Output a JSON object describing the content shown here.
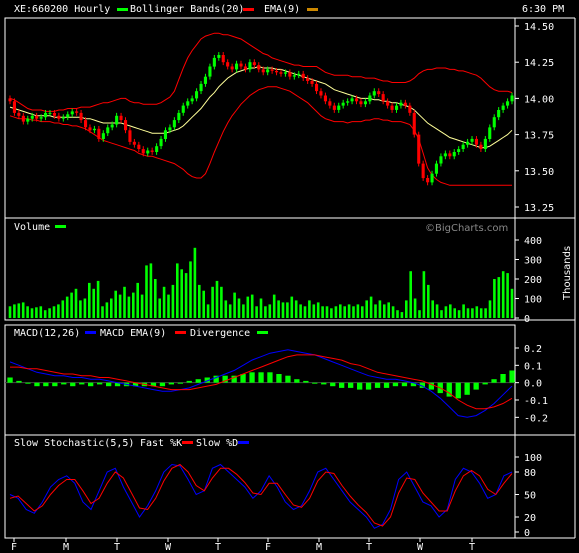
{
  "header": {
    "symbol_label": "XE:660200 Hourly",
    "bb_label": "Bollinger Bands(20)",
    "ema_label": "EMA(9)",
    "time": "6:30 PM"
  },
  "watermark": "©BigCharts.com",
  "colors": {
    "background": "#000000",
    "frame": "#ffffff",
    "up": "#00ff00",
    "down": "#ff0000",
    "bollinger": "#ff0000",
    "ema": "#ffff99",
    "macd": "#0000ff",
    "macd_ema": "#ff0000",
    "divergence": "#00ff00",
    "volume": "#00ff00",
    "fast_k": "#0000ff",
    "slow_d": "#ff0000"
  },
  "chart_data": [
    {
      "type": "candlestick",
      "panel": "price",
      "ylim": [
        13.25,
        14.5
      ],
      "yticks": [
        "14.50",
        "14.25",
        "14.00",
        "13.75",
        "13.50",
        "13.25"
      ],
      "close": [
        13.98,
        13.9,
        13.88,
        13.84,
        13.86,
        13.88,
        13.86,
        13.87,
        13.9,
        13.9,
        13.88,
        13.86,
        13.87,
        13.89,
        13.91,
        13.9,
        13.85,
        13.8,
        13.78,
        13.79,
        13.72,
        13.76,
        13.8,
        13.82,
        13.88,
        13.85,
        13.78,
        13.7,
        13.68,
        13.65,
        13.62,
        13.64,
        13.63,
        13.67,
        13.72,
        13.78,
        13.8,
        13.85,
        13.9,
        13.95,
        13.98,
        14.0,
        14.05,
        14.1,
        14.15,
        14.22,
        14.28,
        14.3,
        14.25,
        14.22,
        14.2,
        14.24,
        14.22,
        14.2,
        14.25,
        14.23,
        14.2,
        14.18,
        14.2,
        14.19,
        14.18,
        14.17,
        14.18,
        14.15,
        14.16,
        14.17,
        14.14,
        14.12,
        14.1,
        14.05,
        14.02,
        13.98,
        13.95,
        13.92,
        13.95,
        13.97,
        13.98,
        14.0,
        13.98,
        13.96,
        13.98,
        14.02,
        14.05,
        14.03,
        13.98,
        13.95,
        13.92,
        13.95,
        13.97,
        13.95,
        13.9,
        13.75,
        13.55,
        13.45,
        13.42,
        13.48,
        13.55,
        13.6,
        13.62,
        13.6,
        13.63,
        13.65,
        13.68,
        13.7,
        13.72,
        13.68,
        13.65,
        13.72,
        13.8,
        13.87,
        13.92,
        13.95,
        13.98,
        14.02
      ],
      "overlays": {
        "bollinger_upper": [
          14.0,
          13.99,
          13.97,
          13.95,
          13.93,
          13.92,
          13.92,
          13.92,
          13.91,
          13.91,
          13.91,
          13.92,
          13.92,
          13.93,
          13.93,
          13.93,
          13.94,
          13.94,
          13.94,
          13.95,
          13.96,
          13.97,
          13.97,
          13.98,
          13.99,
          14.0,
          14.0,
          13.98,
          13.97,
          13.97,
          13.96,
          13.96,
          13.96,
          13.96,
          13.97,
          13.99,
          14.01,
          14.05,
          14.13,
          14.21,
          14.28,
          14.33,
          14.37,
          14.41,
          14.43,
          14.44,
          14.45,
          14.45,
          14.44,
          14.44,
          14.43,
          14.42,
          14.41,
          14.39,
          14.37,
          14.35,
          14.33,
          14.31,
          14.3,
          14.28,
          14.27,
          14.26,
          14.25,
          14.24,
          14.23,
          14.23,
          14.22,
          14.22,
          14.22,
          14.22,
          14.2,
          14.18,
          14.17,
          14.16,
          14.16,
          14.16,
          14.16,
          14.15,
          14.15,
          14.15,
          14.14,
          14.14,
          14.14,
          14.13,
          14.12,
          14.12,
          14.11,
          14.11,
          14.11,
          14.11,
          14.12,
          14.14,
          14.17,
          14.19,
          14.2,
          14.2,
          14.21,
          14.21,
          14.21,
          14.2,
          14.2,
          14.19,
          14.19,
          14.18,
          14.17,
          14.16,
          14.14,
          14.11,
          14.08,
          14.06,
          14.05,
          14.05,
          14.05,
          14.04
        ],
        "bollinger_middle": [
          13.94,
          13.93,
          13.92,
          13.91,
          13.9,
          13.89,
          13.88,
          13.88,
          13.88,
          13.88,
          13.87,
          13.87,
          13.87,
          13.87,
          13.87,
          13.87,
          13.87,
          13.86,
          13.86,
          13.85,
          13.84,
          13.83,
          13.83,
          13.83,
          13.83,
          13.83,
          13.82,
          13.81,
          13.8,
          13.79,
          13.78,
          13.77,
          13.76,
          13.76,
          13.76,
          13.76,
          13.77,
          13.78,
          13.79,
          13.81,
          13.84,
          13.87,
          13.9,
          13.93,
          13.97,
          14.01,
          14.04,
          14.08,
          14.11,
          14.14,
          14.16,
          14.18,
          14.19,
          14.2,
          14.21,
          14.21,
          14.22,
          14.21,
          14.21,
          14.21,
          14.2,
          14.2,
          14.19,
          14.18,
          14.17,
          14.16,
          14.15,
          14.14,
          14.13,
          14.12,
          14.11,
          14.1,
          14.08,
          14.06,
          14.05,
          14.04,
          14.03,
          14.02,
          14.01,
          14.0,
          14.0,
          14.0,
          13.99,
          13.99,
          13.98,
          13.98,
          13.97,
          13.97,
          13.96,
          13.95,
          13.94,
          13.92,
          13.89,
          13.86,
          13.83,
          13.81,
          13.79,
          13.77,
          13.75,
          13.73,
          13.72,
          13.71,
          13.7,
          13.69,
          13.68,
          13.67,
          13.66,
          13.66,
          13.67,
          13.69,
          13.71,
          13.73,
          13.75,
          13.78
        ],
        "bollinger_lower": [
          13.88,
          13.87,
          13.86,
          13.86,
          13.86,
          13.85,
          13.85,
          13.84,
          13.84,
          13.84,
          13.83,
          13.83,
          13.82,
          13.82,
          13.81,
          13.81,
          13.8,
          13.79,
          13.77,
          13.75,
          13.73,
          13.71,
          13.7,
          13.69,
          13.68,
          13.67,
          13.66,
          13.65,
          13.64,
          13.62,
          13.61,
          13.6,
          13.6,
          13.59,
          13.58,
          13.57,
          13.56,
          13.55,
          13.53,
          13.51,
          13.48,
          13.46,
          13.45,
          13.45,
          13.48,
          13.55,
          13.63,
          13.7,
          13.77,
          13.83,
          13.88,
          13.92,
          13.96,
          13.99,
          14.02,
          14.04,
          14.06,
          14.07,
          14.08,
          14.08,
          14.08,
          14.07,
          14.06,
          14.05,
          14.03,
          14.01,
          13.99,
          13.97,
          13.94,
          13.91,
          13.88,
          13.86,
          13.85,
          13.84,
          13.84,
          13.84,
          13.83,
          13.84,
          13.84,
          13.84,
          13.85,
          13.85,
          13.86,
          13.86,
          13.85,
          13.85,
          13.84,
          13.84,
          13.84,
          13.83,
          13.82,
          13.78,
          13.72,
          13.62,
          13.52,
          13.47,
          13.44,
          13.42,
          13.41,
          13.4,
          13.4,
          13.4,
          13.4,
          13.4,
          13.4,
          13.4,
          13.4,
          13.4,
          13.4,
          13.4,
          13.4,
          13.4,
          13.4,
          13.4
        ],
        "ema": [
          13.95,
          13.94,
          13.93,
          13.91,
          13.9,
          13.89,
          13.88,
          13.88,
          13.88,
          13.89,
          13.88,
          13.87,
          13.87,
          13.87,
          13.88,
          13.88,
          13.87,
          13.86,
          13.84,
          13.82,
          13.8,
          13.79,
          13.79,
          13.79,
          13.81,
          13.82,
          13.81,
          13.79,
          13.77,
          13.75,
          13.72,
          13.7,
          13.69,
          13.68,
          13.69,
          13.71,
          13.73,
          13.75,
          13.78,
          13.82,
          13.85,
          13.88,
          13.91,
          13.95,
          13.99,
          14.04,
          14.09,
          14.13,
          14.15,
          14.17,
          14.18,
          14.19,
          14.2,
          14.2,
          14.21,
          14.21,
          14.21,
          14.2,
          14.2,
          14.2,
          14.2,
          14.19,
          14.19,
          14.18,
          14.18,
          14.18,
          14.17,
          14.16,
          14.15,
          14.13,
          14.11,
          14.08,
          14.06,
          14.03,
          14.02,
          14.01,
          14.0,
          14.0,
          14.0,
          13.99,
          13.99,
          13.99,
          14.0,
          14.01,
          14.0,
          13.99,
          13.97,
          13.97,
          13.96,
          13.96,
          13.95,
          13.91,
          13.84,
          13.76,
          13.7,
          13.65,
          13.63,
          13.62,
          13.62,
          13.62,
          13.62,
          13.63,
          13.64,
          13.65,
          13.67,
          13.67,
          13.67,
          13.68,
          13.7,
          13.73,
          13.77,
          13.81,
          13.84,
          13.88
        ]
      }
    },
    {
      "type": "bar",
      "panel": "volume",
      "title": "Volume",
      "ylabel": "Thousands",
      "ylim": [
        0,
        400
      ],
      "yticks": [
        "400",
        "300",
        "200",
        "100",
        "0"
      ],
      "values": [
        60,
        70,
        75,
        80,
        60,
        50,
        55,
        60,
        40,
        50,
        60,
        70,
        90,
        110,
        130,
        150,
        90,
        100,
        180,
        150,
        190,
        60,
        80,
        100,
        140,
        120,
        160,
        110,
        130,
        180,
        120,
        270,
        280,
        200,
        100,
        160,
        120,
        170,
        280,
        250,
        230,
        290,
        360,
        170,
        140,
        70,
        160,
        190,
        160,
        90,
        70,
        130,
        100,
        70,
        110,
        120,
        60,
        100,
        60,
        70,
        120,
        90,
        80,
        80,
        110,
        90,
        70,
        60,
        90,
        70,
        80,
        60,
        60,
        50,
        60,
        70,
        60,
        70,
        60,
        70,
        60,
        90,
        110,
        70,
        90,
        70,
        80,
        60,
        40,
        30,
        90,
        240,
        100,
        40,
        240,
        170,
        90,
        70,
        40,
        60,
        70,
        50,
        40,
        70,
        50,
        50,
        60,
        50,
        50,
        90,
        200,
        210,
        240,
        230,
        150
      ]
    },
    {
      "type": "line",
      "panel": "macd",
      "title": "MACD(12,26)",
      "ylim": [
        -0.25,
        0.2
      ],
      "yticks": [
        "0.2",
        "0.1",
        "0.0",
        "-0.1",
        "-0.2"
      ],
      "series": [
        {
          "name": "MACD(12,26)",
          "values": [
            0.12,
            0.1,
            0.08,
            0.06,
            0.05,
            0.04,
            0.04,
            0.03,
            0.03,
            0.02,
            0.02,
            0.01,
            0.0,
            -0.01,
            -0.02,
            -0.03,
            -0.04,
            -0.05,
            -0.05,
            -0.04,
            -0.03,
            -0.01,
            0.01,
            0.03,
            0.05,
            0.07,
            0.1,
            0.13,
            0.15,
            0.17,
            0.18,
            0.19,
            0.18,
            0.17,
            0.16,
            0.14,
            0.12,
            0.1,
            0.08,
            0.06,
            0.04,
            0.03,
            0.02,
            0.02,
            0.01,
            0.0,
            -0.02,
            -0.05,
            -0.09,
            -0.14,
            -0.19,
            -0.2,
            -0.19,
            -0.16,
            -0.12,
            -0.07,
            -0.02
          ]
        },
        {
          "name": "MACD EMA(9)",
          "values": [
            0.09,
            0.09,
            0.08,
            0.08,
            0.07,
            0.06,
            0.05,
            0.05,
            0.04,
            0.04,
            0.03,
            0.03,
            0.02,
            0.01,
            0.0,
            -0.01,
            -0.02,
            -0.03,
            -0.04,
            -0.04,
            -0.04,
            -0.03,
            -0.02,
            -0.01,
            0.01,
            0.03,
            0.05,
            0.07,
            0.09,
            0.11,
            0.13,
            0.15,
            0.16,
            0.16,
            0.16,
            0.15,
            0.14,
            0.13,
            0.11,
            0.1,
            0.08,
            0.06,
            0.05,
            0.04,
            0.03,
            0.02,
            0.01,
            -0.01,
            -0.03,
            -0.06,
            -0.1,
            -0.13,
            -0.15,
            -0.15,
            -0.14,
            -0.12,
            -0.09
          ]
        },
        {
          "name": "Divergence",
          "values": [
            0.03,
            0.01,
            0.0,
            -0.02,
            -0.02,
            -0.02,
            -0.01,
            -0.02,
            -0.01,
            -0.02,
            -0.01,
            -0.02,
            -0.02,
            -0.02,
            -0.02,
            -0.02,
            -0.02,
            -0.02,
            -0.01,
            0.0,
            0.01,
            0.02,
            0.03,
            0.04,
            0.04,
            0.04,
            0.05,
            0.06,
            0.06,
            0.06,
            0.05,
            0.04,
            0.02,
            0.01,
            0.0,
            -0.01,
            -0.02,
            -0.03,
            -0.03,
            -0.04,
            -0.04,
            -0.03,
            -0.03,
            -0.02,
            -0.02,
            -0.02,
            -0.03,
            -0.04,
            -0.06,
            -0.08,
            -0.09,
            -0.07,
            -0.04,
            -0.01,
            0.02,
            0.05,
            0.07
          ]
        }
      ]
    },
    {
      "type": "line",
      "panel": "stochastic",
      "title": "Slow Stochastic(5,5)",
      "ylim": [
        0,
        100
      ],
      "yticks": [
        "100",
        "80",
        "50",
        "20",
        "0"
      ],
      "series": [
        {
          "name": "Fast %K",
          "values": [
            50,
            45,
            30,
            25,
            40,
            60,
            70,
            75,
            65,
            40,
            30,
            55,
            80,
            85,
            60,
            40,
            20,
            35,
            55,
            80,
            90,
            88,
            70,
            50,
            55,
            85,
            90,
            80,
            70,
            60,
            45,
            55,
            75,
            60,
            40,
            30,
            35,
            55,
            80,
            85,
            70,
            55,
            40,
            30,
            20,
            5,
            10,
            30,
            70,
            80,
            60,
            40,
            35,
            20,
            30,
            70,
            85,
            80,
            65,
            45,
            50,
            75,
            80
          ]
        },
        {
          "name": "Slow %D",
          "values": [
            45,
            48,
            38,
            28,
            35,
            50,
            62,
            70,
            70,
            55,
            38,
            45,
            65,
            80,
            72,
            52,
            32,
            30,
            45,
            68,
            85,
            90,
            80,
            62,
            55,
            72,
            85,
            85,
            77,
            66,
            52,
            50,
            65,
            65,
            50,
            36,
            33,
            45,
            68,
            80,
            78,
            62,
            48,
            36,
            26,
            12,
            8,
            20,
            52,
            72,
            70,
            52,
            40,
            28,
            28,
            55,
            75,
            82,
            75,
            57,
            50,
            65,
            78
          ]
        }
      ]
    }
  ],
  "x_labels": [
    "F",
    "M",
    "T",
    "W",
    "T",
    "F",
    "M",
    "T",
    "W",
    "T"
  ]
}
